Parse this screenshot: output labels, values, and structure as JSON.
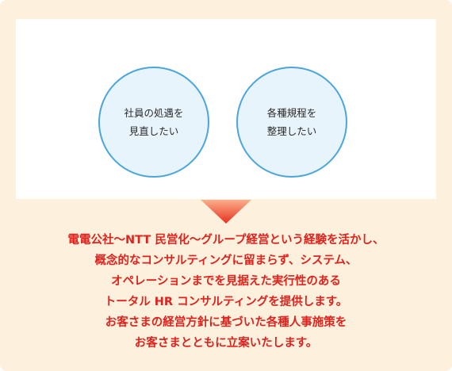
{
  "circles": [
    {
      "line1": "社員の処遇を",
      "line2": "見直したい"
    },
    {
      "line1": "各種規程を",
      "line2": "整理したい"
    }
  ],
  "arrow_icon": "down-arrow-icon",
  "colors": {
    "panel_bg": "#fdf1dd",
    "circle_fill": "#e8f4fb",
    "circle_border": "#4aa6dc",
    "arrow_top": "#fbb08b",
    "arrow_bottom": "#e8301f",
    "message_text": "#e0221d"
  },
  "message": {
    "lines": [
      "電電公社〜NTT 民営化〜グループ経営という経験を活かし、",
      "概念的なコンサルティングに留まらず、システム、",
      "オペレーションまでを見据えた実行性のある",
      "トータル HR コンサルティングを提供します。",
      "お客さまの経営方針に基づいた各種人事施策を",
      "お客さまとともに立案いたします。"
    ]
  }
}
